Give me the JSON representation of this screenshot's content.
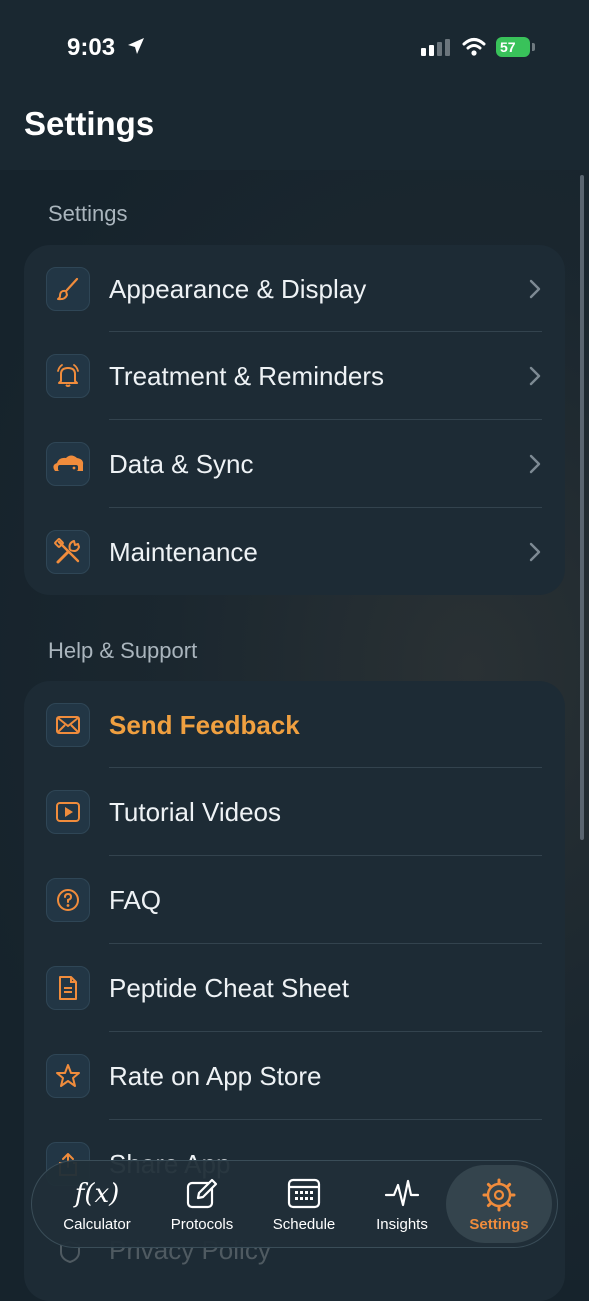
{
  "status_bar": {
    "time": "9:03",
    "battery": "57"
  },
  "header": {
    "title": "Settings"
  },
  "sections": [
    {
      "label": "Settings",
      "items": [
        {
          "label": "Appearance & Display",
          "icon": "paintbrush-icon"
        },
        {
          "label": "Treatment & Reminders",
          "icon": "bell-icon"
        },
        {
          "label": "Data & Sync",
          "icon": "drive-icon"
        },
        {
          "label": "Maintenance",
          "icon": "tools-icon"
        }
      ]
    },
    {
      "label": "Help & Support",
      "items": [
        {
          "label": "Send Feedback",
          "icon": "envelope-icon"
        },
        {
          "label": "Tutorial Videos",
          "icon": "play-icon"
        },
        {
          "label": "FAQ",
          "icon": "question-icon"
        },
        {
          "label": "Peptide Cheat Sheet",
          "icon": "document-icon"
        },
        {
          "label": "Rate on App Store",
          "icon": "star-icon"
        },
        {
          "label": "Share App",
          "icon": "share-icon"
        },
        {
          "label": "Privacy Policy",
          "icon": "shield-icon"
        }
      ]
    }
  ],
  "tabs": [
    {
      "label": "Calculator",
      "icon_text": "f(x)"
    },
    {
      "label": "Protocols"
    },
    {
      "label": "Schedule"
    },
    {
      "label": "Insights"
    },
    {
      "label": "Settings",
      "active": true
    }
  ],
  "colors": {
    "accent": "#f08c3c",
    "feedback": "#f0a040",
    "background": "#16232c",
    "card": "#1d2b35"
  }
}
